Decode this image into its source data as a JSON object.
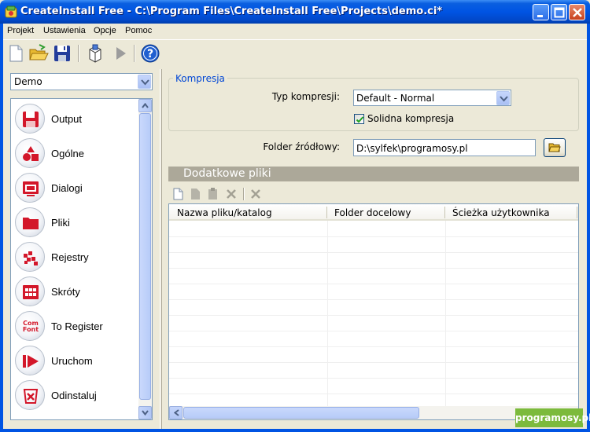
{
  "window": {
    "title": "CreateInstall Free - C:\\Program Files\\CreateInstall Free\\Projects\\demo.ci*"
  },
  "menu": [
    "Projekt",
    "Ustawienia",
    "Opcje",
    "Pomoc"
  ],
  "toolbar": {
    "icons": [
      "new-file-icon",
      "open-folder-icon",
      "save-icon",
      "build-icon",
      "run-icon",
      "help-icon"
    ]
  },
  "project_combo": {
    "value": "Demo"
  },
  "nav": {
    "items": [
      {
        "label": "Output",
        "icon": "save-disk-icon"
      },
      {
        "label": "Ogólne",
        "icon": "shapes-icon"
      },
      {
        "label": "Dialogi",
        "icon": "dialog-window-icon"
      },
      {
        "label": "Pliki",
        "icon": "folder-icon"
      },
      {
        "label": "Rejestry",
        "icon": "registry-icon"
      },
      {
        "label": "Skróty",
        "icon": "shortcut-grid-icon"
      },
      {
        "label": "To Register",
        "icon": "com-font-icon"
      },
      {
        "label": "Uruchom",
        "icon": "run-arrow-icon"
      },
      {
        "label": "Odinstaluj",
        "icon": "uninstall-icon"
      }
    ]
  },
  "compression": {
    "group_label": "Kompresja",
    "type_label": "Typ kompresji:",
    "type_value": "Default - Normal",
    "solid_label": "Solidna kompresja",
    "solid_checked": true
  },
  "source_folder": {
    "label": "Folder źródłowy:",
    "value": "D:\\sylfek\\programosy.pl"
  },
  "additional_files": {
    "section_title": "Dodatkowe pliki",
    "columns": [
      "Nazwa pliku/katalog",
      "Folder docelowy",
      "Ścieżka użytkownika"
    ],
    "rows": []
  },
  "watermark": "programosy.pl",
  "colors": {
    "titlebar": "#0054e3",
    "group_legend": "#0046d5",
    "section_bar": "#aca899",
    "watermark": "#7cba3c",
    "nav_icon_red": "#d3172a"
  }
}
